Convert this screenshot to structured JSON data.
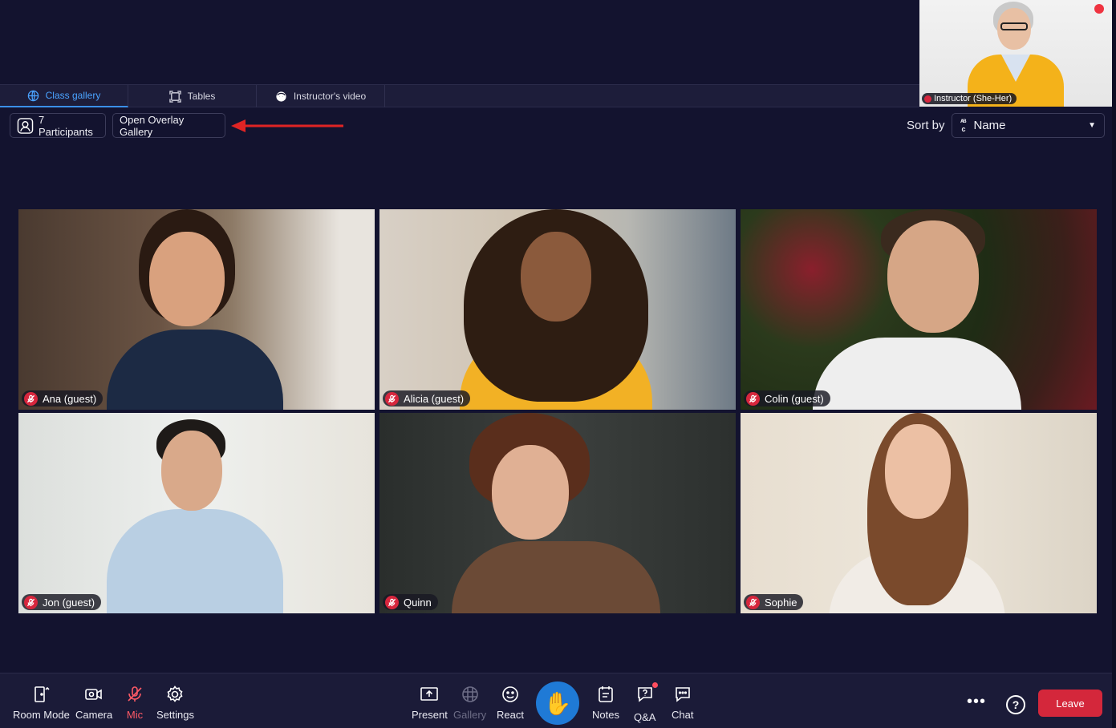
{
  "instructor": {
    "label": "Instructor (She-Her)"
  },
  "tabs": [
    {
      "label": "Class gallery",
      "icon": "globe-icon"
    },
    {
      "label": "Tables",
      "icon": "tables-icon"
    },
    {
      "label": "Instructor's video",
      "icon": "instructor-face-icon"
    }
  ],
  "toolbar": {
    "participants_label": "7 Participants",
    "overlay_label": "Open Overlay Gallery",
    "sort_by_label": "Sort by",
    "sort_value": "Name"
  },
  "participants": [
    {
      "name": "Ana (guest)"
    },
    {
      "name": "Alicia (guest)"
    },
    {
      "name": "Colin (guest)"
    },
    {
      "name": "Jon (guest)"
    },
    {
      "name": "Quinn"
    },
    {
      "name": "Sophie"
    }
  ],
  "bottombar": {
    "room_mode": "Room Mode",
    "camera": "Camera",
    "mic": "Mic",
    "settings": "Settings",
    "present": "Present",
    "gallery": "Gallery",
    "react": "React",
    "notes": "Notes",
    "qa": "Q&A",
    "chat": "Chat",
    "help": "?",
    "leave": "Leave"
  },
  "colors": {
    "background": "#13132f",
    "accent": "#3a8fe8",
    "leave": "#d4273b",
    "muted": "#d7263d",
    "annotation_arrow": "#e02424"
  }
}
